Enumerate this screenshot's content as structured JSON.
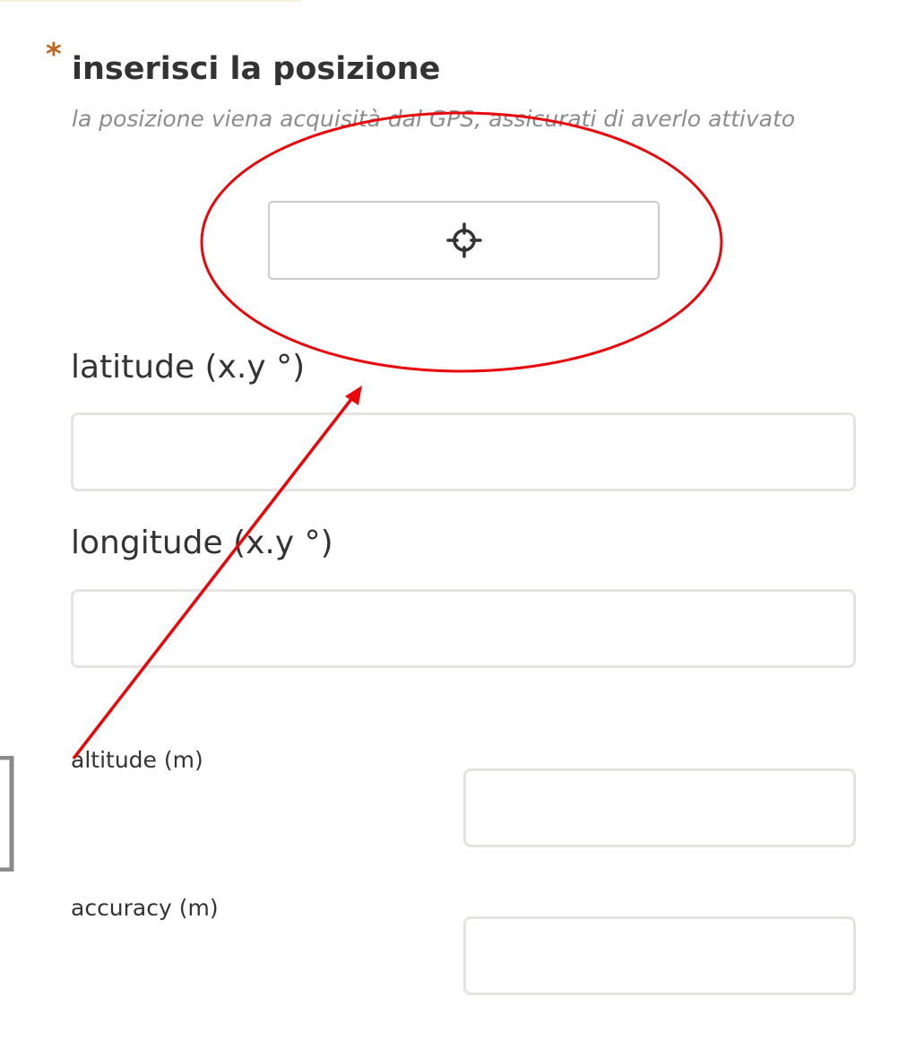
{
  "section": {
    "required_marker": "*",
    "title": "inserisci la posizione",
    "hint": "la posizione viena acquisità dal GPS, assicurati di averlo attivato"
  },
  "gps_button": {
    "icon": "crosshair-icon"
  },
  "fields": {
    "latitude": {
      "label": "latitude (x.y °)",
      "value": ""
    },
    "longitude": {
      "label": "longitude (x.y °)",
      "value": ""
    },
    "altitude": {
      "label": "altitude (m)",
      "value": ""
    },
    "accuracy": {
      "label": "accuracy (m)",
      "value": ""
    }
  },
  "annotation": {
    "color": "#e8070b",
    "shapes": [
      "ellipse",
      "arrow"
    ]
  },
  "colors": {
    "required": "#c0661e",
    "text": "#333333",
    "hint": "#8c8c8c",
    "input_border": "#e6e4e0"
  }
}
